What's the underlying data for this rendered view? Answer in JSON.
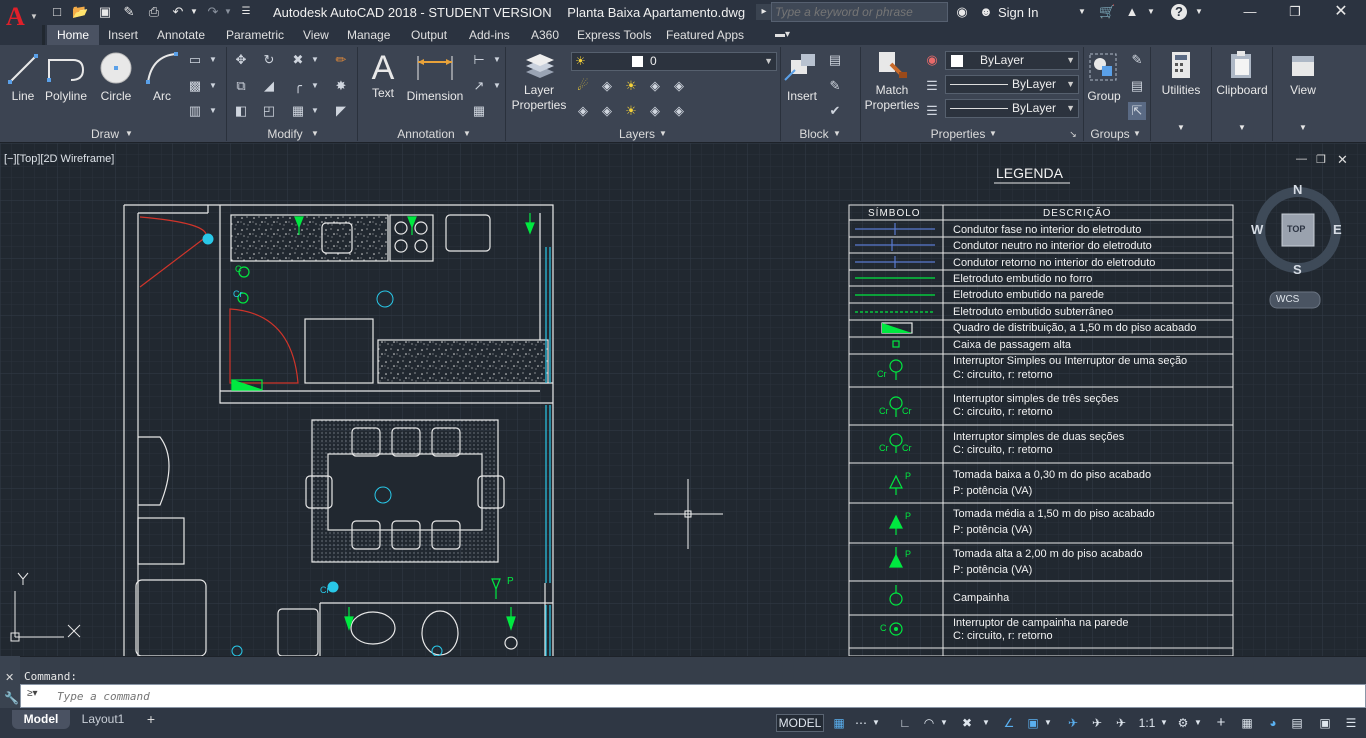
{
  "app": {
    "title": "Autodesk AutoCAD 2018 - STUDENT VERSION",
    "document": "Planta Baixa Apartamento.dwg",
    "logo": "A"
  },
  "search": {
    "placeholder": "Type a keyword or phrase"
  },
  "account": {
    "sign_in": "Sign In"
  },
  "tabs": [
    "Home",
    "Insert",
    "Annotate",
    "Parametric",
    "View",
    "Manage",
    "Output",
    "Add-ins",
    "A360",
    "Express Tools",
    "Featured Apps"
  ],
  "ribbon": {
    "draw": {
      "panel": "Draw",
      "tools": [
        "Line",
        "Polyline",
        "Circle",
        "Arc"
      ]
    },
    "modify": {
      "panel": "Modify"
    },
    "annotation": {
      "panel": "Annotation",
      "tools": [
        "Text",
        "Dimension"
      ]
    },
    "layers": {
      "panel": "Layers",
      "tool_top": "Layer",
      "tool_bottom": "Properties",
      "current_layer": "0"
    },
    "block": {
      "panel": "Block",
      "tool": "Insert"
    },
    "properties": {
      "panel": "Properties",
      "tool_top": "Match",
      "tool_bottom": "Properties",
      "color": "ByLayer",
      "linetype": "ByLayer",
      "lineweight": "ByLayer"
    },
    "groups": {
      "panel": "Groups",
      "tool": "Group"
    },
    "utilities": {
      "tool": "Utilities"
    },
    "clipboard": {
      "tool": "Clipboard"
    },
    "view": {
      "tool": "View"
    }
  },
  "viewport": {
    "label": "[−][Top][2D Wireframe]"
  },
  "viewcube": {
    "n": "N",
    "s": "S",
    "e": "E",
    "w": "W",
    "face": "TOP",
    "wcs": "WCS"
  },
  "ucs": {
    "x": "X",
    "y": "Y"
  },
  "legend": {
    "title": "LEGENDA",
    "col_symbol": "SÍMBOLO",
    "col_desc": "DESCRIÇÃO",
    "rows": [
      {
        "l1": "Condutor fase no interior do eletroduto",
        "l2": ""
      },
      {
        "l1": "Condutor neutro no interior do eletroduto",
        "l2": ""
      },
      {
        "l1": "Condutor retorno no interior do eletroduto",
        "l2": ""
      },
      {
        "l1": "Eletroduto embutido no forro",
        "l2": ""
      },
      {
        "l1": "Eletroduto embutido na parede",
        "l2": ""
      },
      {
        "l1": "Eletroduto embutido subterrâneo",
        "l2": ""
      },
      {
        "l1": "Quadro de distribuição, a 1,50 m do piso acabado",
        "l2": ""
      },
      {
        "l1": "Caixa de passagem alta",
        "l2": ""
      },
      {
        "l1": "Interruptor Simples ou Interruptor de uma seção",
        "l2": "C: circuito, r: retorno"
      },
      {
        "l1": "Interruptor simples de três seções",
        "l2": "C: circuito, r: retorno"
      },
      {
        "l1": "Interruptor simples de duas seções",
        "l2": "C: circuito, r: retorno"
      },
      {
        "l1": "Tomada baixa a 0,30 m do piso acabado",
        "l2": "P: potência (VA)"
      },
      {
        "l1": "Tomada média a 1,50 m do piso acabado",
        "l2": "P: potência (VA)"
      },
      {
        "l1": "Tomada alta a 2,00 m do piso acabado",
        "l2": "P: potência (VA)"
      },
      {
        "l1": "Campainha",
        "l2": ""
      },
      {
        "l1": "Interruptor de campainha na parede",
        "l2": "C: circuito, r: retorno"
      }
    ],
    "sym_cr": "Cr",
    "sym_c": "C",
    "sym_p": "P"
  },
  "command": {
    "history": "Command:",
    "placeholder": "Type a command"
  },
  "layout_tabs": [
    "Model",
    "Layout1"
  ],
  "status": {
    "model": "MODEL",
    "scale": "1:1"
  }
}
